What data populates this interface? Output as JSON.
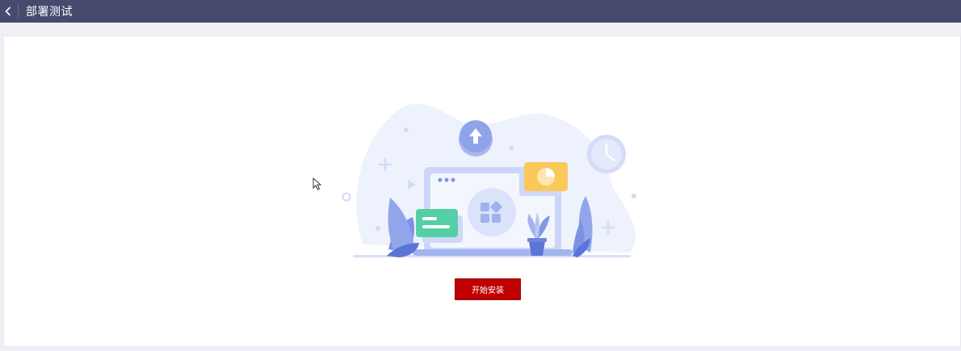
{
  "header": {
    "back_icon": "chevron-left-icon",
    "title": "部署测试"
  },
  "main": {
    "install_button_label": "开始安装",
    "illustration": "laptop-upload-illustration"
  },
  "colors": {
    "header_bg": "#464b6e",
    "primary_button": "#c00000",
    "page_bg": "#eef0f5"
  }
}
